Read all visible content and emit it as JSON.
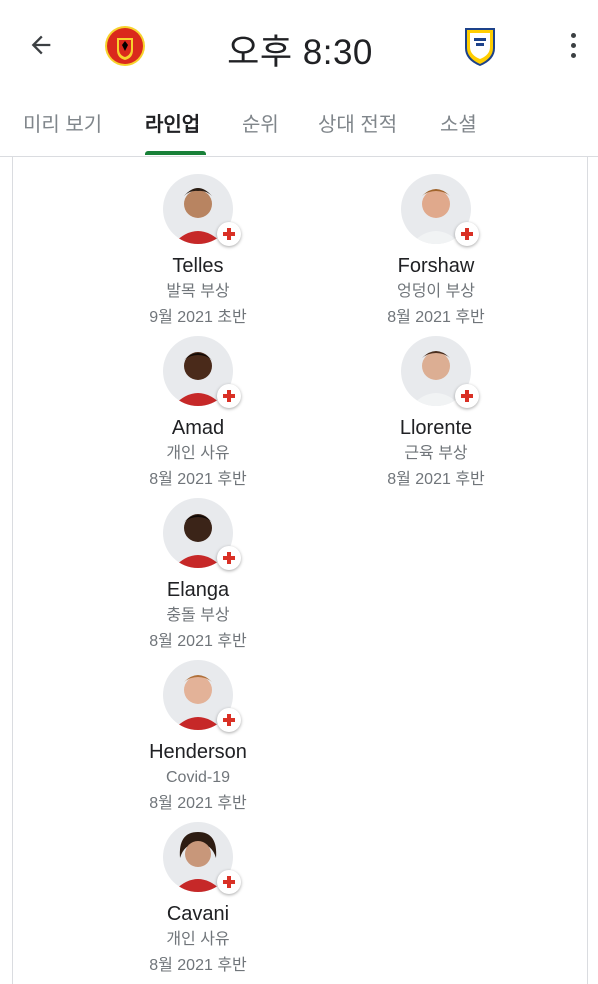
{
  "header": {
    "time": "오후 8:30",
    "home_team_icon": "manchester-united-crest-icon",
    "away_team_icon": "leeds-united-crest-icon"
  },
  "tabs": [
    {
      "label": "미리 보기",
      "active": false
    },
    {
      "label": "라인업",
      "active": true
    },
    {
      "label": "순위",
      "active": false
    },
    {
      "label": "상대 전적",
      "active": false
    },
    {
      "label": "소셜",
      "active": false
    }
  ],
  "colors": {
    "accent": "#188038",
    "injury_cross": "#d93025",
    "muted_text": "#70757a"
  },
  "home_injuries": [
    {
      "name": "Telles",
      "reason": "발목 부상",
      "return": "9월 2021 초반"
    },
    {
      "name": "Amad",
      "reason": "개인 사유",
      "return": "8월 2021 후반"
    },
    {
      "name": "Elanga",
      "reason": "충돌 부상",
      "return": "8월 2021 후반"
    },
    {
      "name": "Henderson",
      "reason": "Covid-19",
      "return": "8월 2021 후반"
    },
    {
      "name": "Cavani",
      "reason": "개인 사유",
      "return": "8월 2021 후반"
    }
  ],
  "away_injuries": [
    {
      "name": "Forshaw",
      "reason": "엉덩이 부상",
      "return": "8월 2021 후반"
    },
    {
      "name": "Llorente",
      "reason": "근육 부상",
      "return": "8월 2021 후반"
    }
  ]
}
